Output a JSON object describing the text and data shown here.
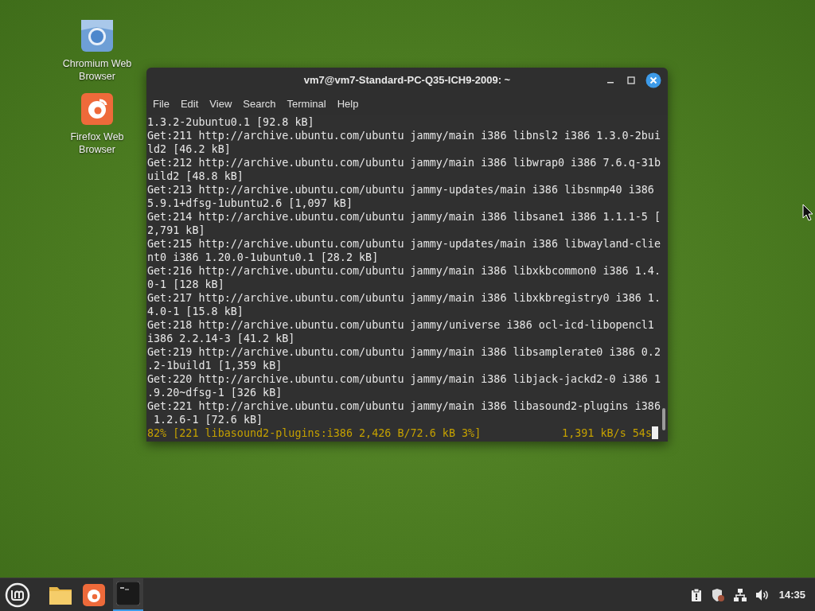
{
  "desktop_icons": [
    {
      "kind": "chromium",
      "label": "Chromium Web Browser"
    },
    {
      "kind": "firefox",
      "label": "Firefox Web Browser"
    }
  ],
  "window": {
    "title": "vm7@vm7-Standard-PC-Q35-ICH9-2009: ~"
  },
  "menu": [
    "File",
    "Edit",
    "View",
    "Search",
    "Terminal",
    "Help"
  ],
  "terminal_lines": [
    "1.3.2-2ubuntu0.1 [92.8 kB]",
    "Get:211 http://archive.ubuntu.com/ubuntu jammy/main i386 libnsl2 i386 1.3.0-2bui",
    "ld2 [46.2 kB]",
    "Get:212 http://archive.ubuntu.com/ubuntu jammy/main i386 libwrap0 i386 7.6.q-31b",
    "uild2 [48.8 kB]",
    "Get:213 http://archive.ubuntu.com/ubuntu jammy-updates/main i386 libsnmp40 i386",
    "5.9.1+dfsg-1ubuntu2.6 [1,097 kB]",
    "Get:214 http://archive.ubuntu.com/ubuntu jammy/main i386 libsane1 i386 1.1.1-5 [",
    "2,791 kB]",
    "Get:215 http://archive.ubuntu.com/ubuntu jammy-updates/main i386 libwayland-clie",
    "nt0 i386 1.20.0-1ubuntu0.1 [28.2 kB]",
    "Get:216 http://archive.ubuntu.com/ubuntu jammy/main i386 libxkbcommon0 i386 1.4.",
    "0-1 [128 kB]",
    "Get:217 http://archive.ubuntu.com/ubuntu jammy/main i386 libxkbregistry0 i386 1.",
    "4.0-1 [15.8 kB]",
    "Get:218 http://archive.ubuntu.com/ubuntu jammy/universe i386 ocl-icd-libopencl1",
    "i386 2.2.14-3 [41.2 kB]",
    "Get:219 http://archive.ubuntu.com/ubuntu jammy/main i386 libsamplerate0 i386 0.2",
    ".2-1build1 [1,359 kB]",
    "Get:220 http://archive.ubuntu.com/ubuntu jammy/main i386 libjack-jackd2-0 i386 1",
    ".9.20~dfsg-1 [326 kB]",
    "Get:221 http://archive.ubuntu.com/ubuntu jammy/main i386 libasound2-plugins i386",
    " 1.2.6-1 [72.6 kB]"
  ],
  "progress": {
    "status": "82% [221 libasound2-plugins:i386 2,426 B/72.6 kB 3%]",
    "speed": "1,391 kB/s 54s"
  },
  "taskbar": {
    "apps": [
      {
        "kind": "files",
        "selected": false
      },
      {
        "kind": "firefox",
        "selected": false
      },
      {
        "kind": "terminal",
        "selected": true
      }
    ],
    "clock": "14:35"
  }
}
